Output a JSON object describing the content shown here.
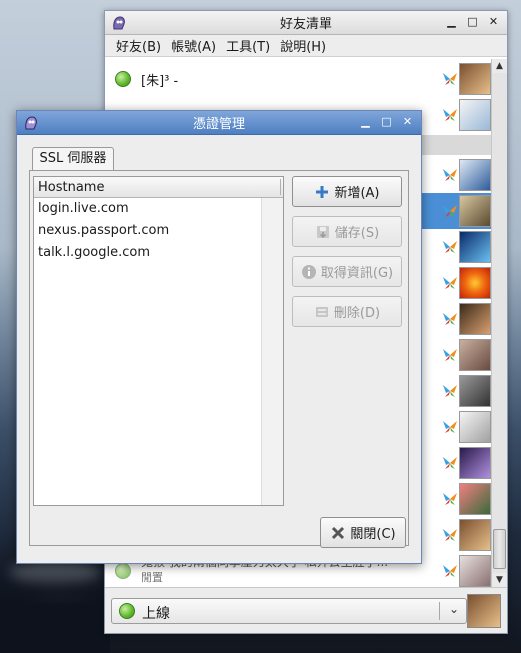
{
  "buddy_window": {
    "title": "好友清單",
    "menu": [
      {
        "label": "好友(B)",
        "key": "B"
      },
      {
        "label": "帳號(A)",
        "key": "A"
      },
      {
        "label": "工具(T)",
        "key": "T"
      },
      {
        "label": "說明(H)",
        "key": "H"
      }
    ],
    "first_buddy": "[朱]³ -",
    "partial_buddy": "鬼猴 我的兩個同學壓力太大了 私奔去生肚了...",
    "partial_buddy_status": "閒置",
    "status": "上線",
    "colors": {
      "selected_row": "#4a8fd6",
      "status_green": "#66bb33"
    }
  },
  "cert_dialog": {
    "title": "憑證管理",
    "tab_label": "SSL 伺服器",
    "column_header": "Hostname",
    "hosts": [
      "login.live.com",
      "nexus.passport.com",
      "talk.l.google.com"
    ],
    "buttons": {
      "add": "新增(A)",
      "save": "儲存(S)",
      "info": "取得資訊(G)",
      "delete": "刪除(D)",
      "close": "關閉(C)"
    },
    "title_color": "#4f7fc2"
  }
}
